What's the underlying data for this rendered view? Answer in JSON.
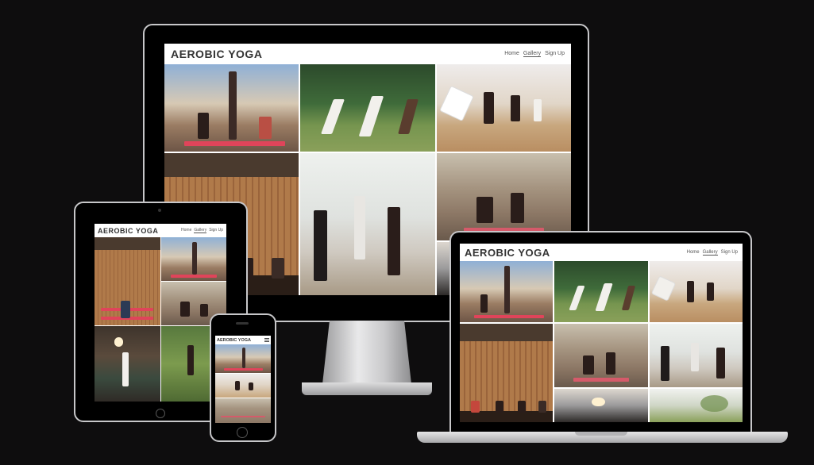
{
  "site": {
    "logo": "AEROBIC YOGA",
    "nav": [
      {
        "label": "Home",
        "active": false
      },
      {
        "label": "Gallery",
        "active": true
      },
      {
        "label": "Sign Up",
        "active": false
      }
    ],
    "menu_icon": "hamburger-menu-icon"
  },
  "colors": {
    "background": "#0e0d0e",
    "device_frame": "#000000",
    "device_silver": "#c9c9cb",
    "header_bg": "#ffffff",
    "mat_red": "#e0445a"
  },
  "gallery_photos": [
    {
      "id": "rooftop-class",
      "scene": "outdoor rooftop yoga class"
    },
    {
      "id": "park-class",
      "scene": "triangle pose in park"
    },
    {
      "id": "studio-downdog",
      "scene": "downward dog in studio"
    },
    {
      "id": "loft-class",
      "scene": "yoga in brick loft"
    },
    {
      "id": "wood-wall-class",
      "scene": "chair pose before wooden wall"
    },
    {
      "id": "bright-studio",
      "scene": "warrior pose in bright studio"
    },
    {
      "id": "home-yoga",
      "scene": "yoga at home"
    },
    {
      "id": "grass-yoga",
      "scene": "yoga on grass"
    }
  ]
}
